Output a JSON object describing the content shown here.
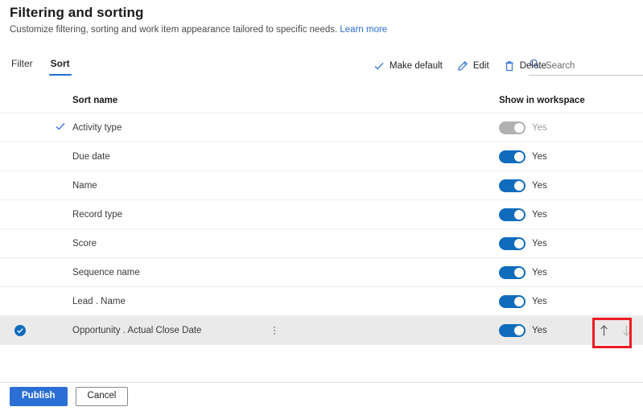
{
  "header": {
    "title": "Filtering and sorting",
    "subtitle": "Customize filtering, sorting and work item appearance tailored to specific needs.",
    "learn_more": "Learn more"
  },
  "tabs": [
    {
      "label": "Filter",
      "active": false
    },
    {
      "label": "Sort",
      "active": true
    }
  ],
  "toolbar": {
    "make_default_label": "Make default",
    "edit_label": "Edit",
    "delete_label": "Delete",
    "search_placeholder": "Search",
    "search_value": ""
  },
  "table": {
    "columns": {
      "sort_name": "Sort name",
      "show_in_workspace": "Show in workspace"
    },
    "rows": [
      {
        "name": "Activity type",
        "default": true,
        "selected": false,
        "toggle_on": true,
        "toggle_disabled": true,
        "toggle_label": "Yes"
      },
      {
        "name": "Due date",
        "default": false,
        "selected": false,
        "toggle_on": true,
        "toggle_disabled": false,
        "toggle_label": "Yes"
      },
      {
        "name": "Name",
        "default": false,
        "selected": false,
        "toggle_on": true,
        "toggle_disabled": false,
        "toggle_label": "Yes"
      },
      {
        "name": "Record type",
        "default": false,
        "selected": false,
        "toggle_on": true,
        "toggle_disabled": false,
        "toggle_label": "Yes"
      },
      {
        "name": "Score",
        "default": false,
        "selected": false,
        "toggle_on": true,
        "toggle_disabled": false,
        "toggle_label": "Yes"
      },
      {
        "name": "Sequence name",
        "default": false,
        "selected": false,
        "toggle_on": true,
        "toggle_disabled": false,
        "toggle_label": "Yes"
      },
      {
        "name": "Lead . Name",
        "default": false,
        "selected": false,
        "toggle_on": true,
        "toggle_disabled": false,
        "toggle_label": "Yes"
      },
      {
        "name": "Opportunity . Actual Close Date",
        "default": false,
        "selected": true,
        "toggle_on": true,
        "toggle_disabled": false,
        "toggle_label": "Yes"
      }
    ]
  },
  "footer": {
    "publish_label": "Publish",
    "cancel_label": "Cancel"
  },
  "icons": {
    "make_default": "checkmark-icon",
    "edit": "pencil-icon",
    "delete": "trash-icon",
    "search": "search-icon",
    "overflow": "more-vertical-icon",
    "move_up": "arrow-up-icon",
    "move_down": "arrow-down-icon",
    "selected_row": "checkbox-checked-icon"
  },
  "colors": {
    "accent": "#2b6fd6",
    "toggle_on": "#0f6cbd",
    "toggle_disabled": "#b1b1b1",
    "annotation": "#ec1c24",
    "selected_row_bg": "#ebeaea"
  }
}
